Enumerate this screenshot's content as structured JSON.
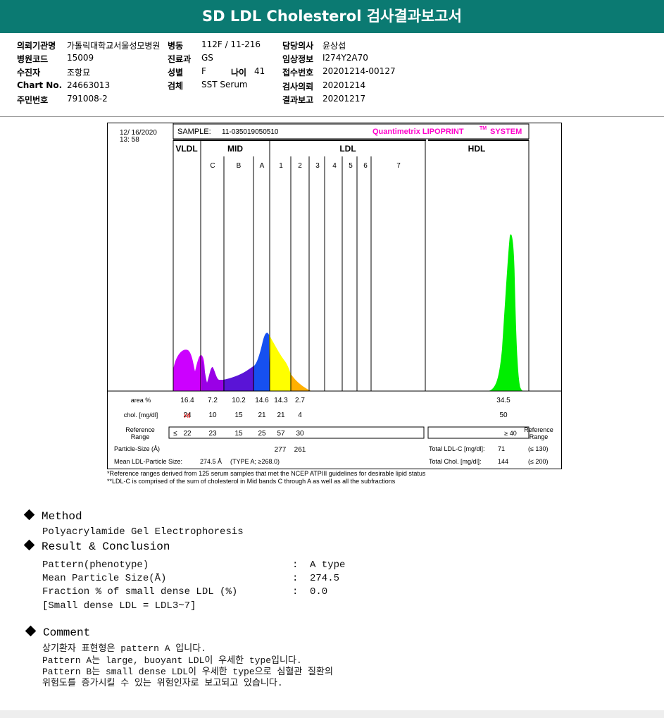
{
  "title": "SD LDL Cholesterol 검사결과보고서",
  "info": {
    "institution_label": "의뢰기관명",
    "institution_value": "가톨릭대학교서울성모병원",
    "ward_label": "병동",
    "ward_value": "112F / 11-216",
    "doctor_label": "담당의사",
    "doctor_value": "윤상섭",
    "hospital_code_label": "병원코드",
    "hospital_code_value": "15009",
    "department_label": "진료과",
    "department_value": "GS",
    "clinical_label": "임상정보",
    "clinical_value": "I274Y2A70",
    "patient_label": "수진자",
    "patient_value": "조항묘",
    "sex_label": "성별",
    "sex_value": "F",
    "age_label": "나이",
    "age_value": "41",
    "reception_label": "접수번호",
    "reception_value": "20201214-00127",
    "chart_label": "Chart No.",
    "chart_value": "24663013",
    "specimen_label": "검체",
    "specimen_value": "SST Serum",
    "request_label": "검사의뢰",
    "request_value": "20201214",
    "id_label": "주민번호",
    "id_value": "791008-2",
    "report_label": "결과보고",
    "report_value": "20201217"
  },
  "chart": {
    "date": "12/ 16/2020",
    "time": "13: 58",
    "sample_label": "SAMPLE:",
    "sample_id": "11-035019050510",
    "brand": "Quantimetrix LIPOPRINT",
    "brand_tm": "TM",
    "brand_suffix": "SYSTEM",
    "groups": [
      "VLDL",
      "MID",
      "LDL",
      "HDL"
    ],
    "bands": [
      "C",
      "B",
      "A",
      "1",
      "2",
      "3",
      "4",
      "5",
      "6",
      "7"
    ],
    "area_label": "area %",
    "chol_label": "chol. [mg/dl]",
    "ref_label_1": "Reference",
    "ref_label_2": "Range",
    "particle_label": "Particle-Size (Å)",
    "mean_label": "Mean LDL-Particle Size:",
    "mean_value": "274.5 Å",
    "mean_type": "(TYPE A; ≥268.0)",
    "hi_flag": "HI",
    "le_symbol": "≤",
    "total_ldl_label": "Total LDL-C [mg/dl]:",
    "total_ldl_value": "71",
    "total_ldl_ref": "(≤ 130)",
    "total_chol_label": "Total Chol. [mg/dl]:",
    "total_chol_value": "144",
    "total_chol_ref": "(≤ 200)",
    "hdl_ref": "≥ 40"
  },
  "chart_data": {
    "type": "table",
    "columns": [
      "VLDL",
      "C",
      "B",
      "A",
      "1",
      "2",
      "HDL"
    ],
    "area_percent": [
      "16.4",
      "7.2",
      "10.2",
      "14.6",
      "14.3",
      "2.7",
      "34.5"
    ],
    "chol_mg_dl": [
      "24",
      "10",
      "15",
      "21",
      "21",
      "4",
      "50"
    ],
    "reference_range": [
      "22",
      "23",
      "15",
      "25",
      "57",
      "30"
    ],
    "particle_size": [
      "277",
      "261"
    ],
    "colors": {
      "vldl": "#cc00ff",
      "mid_c": "#9a00e6",
      "mid_b": "#5a14d6",
      "mid_a": "#1650f0",
      "ldl1": "#ffff00",
      "ldl2": "#ffb000",
      "hdl": "#00ee00",
      "hi": "#ff0000",
      "brand": "#ff00cc"
    }
  },
  "notes": [
    "*Reference ranges derived from 125 serum samples that met the NCEP ATPIII guidelines for desirable lipid status",
    "**LDL-C is comprised of the sum of cholesterol in Mid bands C through A as well as all the subfractions"
  ],
  "method": {
    "heading": "Method",
    "text": "Polyacrylamide Gel Electrophoresis"
  },
  "result": {
    "heading": "Result & Conclusion",
    "rows": [
      {
        "label": "Pattern(phenotype)",
        "colon": ":",
        "value": "A type"
      },
      {
        "label": "Mean Particle Size(Å)",
        "colon": ":",
        "value": "274.5"
      },
      {
        "label": "Fraction % of small dense LDL (%)",
        "colon": ":",
        "value": "0.0"
      }
    ],
    "note": "[Small dense LDL = LDL3~7]"
  },
  "comment": {
    "heading": "Comment",
    "lines": [
      "상기환자 표현형은 pattern A 입니다.",
      "Pattern A는 large, buoyant LDL이 우세한 type입니다.",
      "Pattern B는 small dense LDL이 우세한 type으로 심혈관 질환의",
      "위험도를 증가시킬 수 있는 위험인자로 보고되고 있습니다."
    ]
  }
}
